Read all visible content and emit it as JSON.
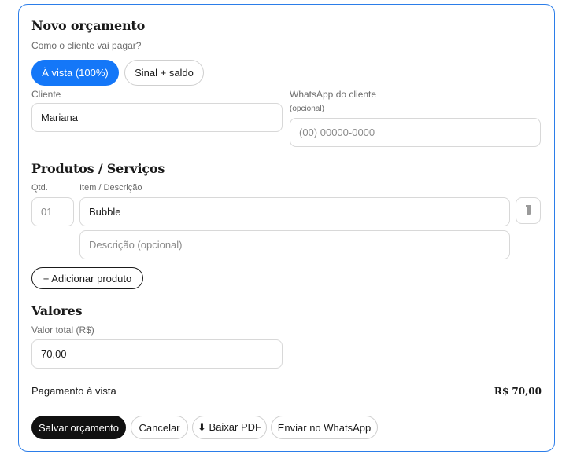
{
  "form": {
    "title": "Novo orçamento",
    "payment_question": "Como o cliente vai pagar?",
    "payment_options": [
      {
        "label": "À vista (100%)",
        "selected": true
      },
      {
        "label": "Sinal + saldo",
        "selected": false
      }
    ]
  },
  "client": {
    "label": "Cliente",
    "value": "Mariana"
  },
  "whatsapp": {
    "label": "WhatsApp do cliente",
    "hint": "(opcional)",
    "placeholder": "(00) 00000-0000"
  },
  "products": {
    "title": "Produtos / Serviços",
    "qty_label": "Qtd.",
    "item_label": "Item / Descrição",
    "rows": [
      {
        "qty_placeholder": "01",
        "item_value": "Bubble",
        "description_placeholder": "Descrição (opcional)"
      }
    ],
    "add_label": "+  Adicionar produto"
  },
  "values": {
    "title": "Valores",
    "total_label": "Valor total (R$)",
    "total_value": "70,00"
  },
  "summary": {
    "label": "Pagamento à vista",
    "amount": "R$ 70,00"
  },
  "actions": {
    "save": "Salvar orçamento",
    "cancel": "Cancelar",
    "pdf": "⬇ Baixar PDF",
    "whatsapp": "Enviar no WhatsApp"
  },
  "colors": {
    "accent": "#1477f8",
    "card_border": "#2b7de9",
    "primary_dark": "#111111"
  },
  "icons": {
    "trash": "trash-icon"
  }
}
